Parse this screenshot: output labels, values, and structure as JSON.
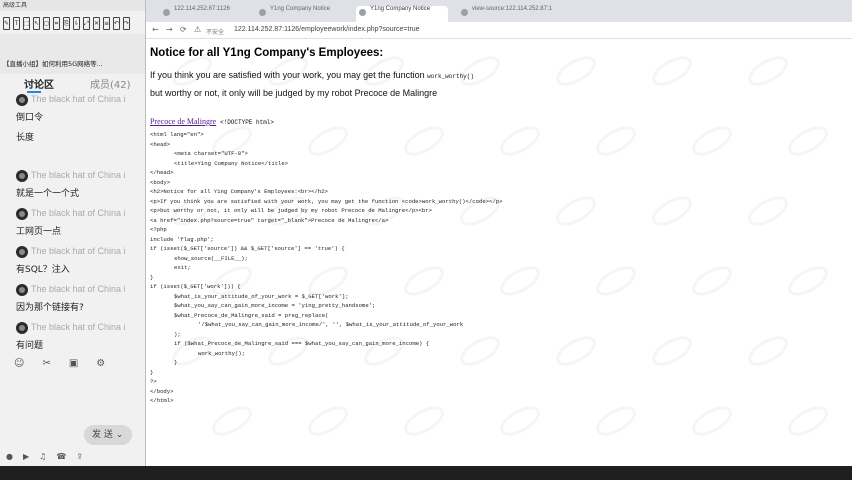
{
  "left_panel": {
    "window_title": "高级工具",
    "toolbar_icons": [
      "pen-icon",
      "text-icon",
      "select-icon",
      "pointer-icon",
      "shape-icon",
      "crop-icon",
      "copy-icon",
      "save-icon",
      "fullscreen-icon",
      "close-icon",
      "settings-icon",
      "undo-icon",
      "redo-icon"
    ],
    "stream_title": "【直播小组】如何利用5G网络等...",
    "tabs": {
      "discuss": "讨论区",
      "members": "成员(42)"
    },
    "messages": [
      {
        "name": "The black hat of China i",
        "text": "倒口令"
      },
      {
        "name": "",
        "text": "长度"
      },
      {
        "name": "The black hat of China i",
        "text": "就是一个一个式"
      },
      {
        "name": "The black hat of China i",
        "text": "工网页一点"
      },
      {
        "name": "The black hat of China i",
        "text": "有SQL？注入"
      },
      {
        "name": "The black hat of China i",
        "text": "因为那个链接有?"
      },
      {
        "name": "The black hat of China i",
        "text": "有问题"
      }
    ],
    "bottom_icons": [
      "emoji-icon",
      "scissors-icon",
      "image-icon",
      "gear-icon"
    ],
    "send_label": "发 送",
    "footer_icons": [
      "mic-icon",
      "video-icon",
      "music-icon",
      "phone-icon",
      "share-icon"
    ]
  },
  "browser": {
    "tabs": [
      {
        "title": "122.114.252.87:1126"
      },
      {
        "title": "Y1ng Company Notice"
      },
      {
        "title": "Y1ng Company Notice"
      },
      {
        "title": "view-source:122.114.252.87:1"
      }
    ],
    "security_label": "不安全",
    "url": "122.114.252.87:1126/employeework/index.php?source=true"
  },
  "page": {
    "heading": "Notice for all Y1ng Company's Employees:",
    "p1_text": "If you think you are satisfied with your work, you may get the function",
    "p1_code": "work_worthy()",
    "p2_text": "but worthy or not, it only will be judged by my robot Precoce de Malingre",
    "source_link": "Precoce de Malingre",
    "source_first": "<!DOCTYPE html>",
    "source_lines": [
      {
        "text": "<html lang=\"en\">",
        "indent": 0,
        "style": "plain"
      },
      {
        "text": "<head>",
        "indent": 0,
        "style": "plain"
      },
      {
        "text": "<meta charset=\"UTF-8\">",
        "indent": 4,
        "style": "plain"
      },
      {
        "text": "<title>Y1ng Company Notice</title>",
        "indent": 4,
        "style": "plain"
      },
      {
        "text": "</head>",
        "indent": 0,
        "style": "plain"
      },
      {
        "text": "<body>",
        "indent": 0,
        "style": "plain"
      },
      {
        "text": "<h2>Notice for all Y1ng Company's Employees:<br></h2>",
        "indent": 0,
        "style": "plain"
      },
      {
        "text": "<p>If you think you are satisfied with your work, you may get the function <code>work_worthy()</code></p>",
        "indent": 0,
        "style": "plain"
      },
      {
        "text": "<p>but worthy or not, it only will be judged by my robot Precoce de Malingre</p><br>",
        "indent": 0,
        "style": "plain"
      },
      {
        "text": "<a href=\"index.php?source=true\" target=\"_blank\">Precoce de Malingre</a>",
        "indent": 0,
        "style": "plain"
      },
      {
        "text": "<?php",
        "indent": 0,
        "style": "plain"
      },
      {
        "text": "include 'flag.php';",
        "indent": 0,
        "style": "plain"
      },
      {
        "text": "if (isset($_GET['source']) && $_GET['source'] == 'true') {",
        "indent": 0,
        "style": "plain"
      },
      {
        "text": "show_source(__FILE__);",
        "indent": 4,
        "style": "plain"
      },
      {
        "text": "exit;",
        "indent": 4,
        "style": "plain"
      },
      {
        "text": "}",
        "indent": 0,
        "style": "plain"
      },
      {
        "text": "if (isset($_GET['work'])) {",
        "indent": 0,
        "style": "plain"
      },
      {
        "text": "$what_is_your_attitude_of_your_work = $_GET['work'];",
        "indent": 4,
        "style": "plain"
      },
      {
        "text": "$what_you_say_can_gain_more_income = 'y1ng_pretty_handsome';",
        "indent": 4,
        "style": "plain"
      },
      {
        "text": "$what_Precoce_de_Malingre_said = preg_replace(",
        "indent": 4,
        "style": "plain"
      },
      {
        "text": "'/$what_you_say_can_gain_more_income/', '', $what_is_your_attitude_of_your_work",
        "indent": 8,
        "style": "plain"
      },
      {
        "text": ");",
        "indent": 4,
        "style": "plain"
      },
      {
        "text": "if ($what_Precoce_de_Malingre_said === $what_you_say_can_gain_more_income) {",
        "indent": 4,
        "style": "plain"
      },
      {
        "text": "work_worthy();",
        "indent": 8,
        "style": "plain"
      },
      {
        "text": "}",
        "indent": 4,
        "style": "plain"
      },
      {
        "text": "}",
        "indent": 0,
        "style": "plain"
      },
      {
        "text": "?>",
        "indent": 0,
        "style": "plain"
      },
      {
        "text": "</body>",
        "indent": 0,
        "style": "plain"
      },
      {
        "text": "</html>",
        "indent": 0,
        "style": "plain"
      }
    ]
  },
  "colors": {
    "accent": "#1e88e5",
    "link": "#551a8b",
    "page_bg": "#ffffff",
    "panel_bg": "#f1f1f1"
  }
}
